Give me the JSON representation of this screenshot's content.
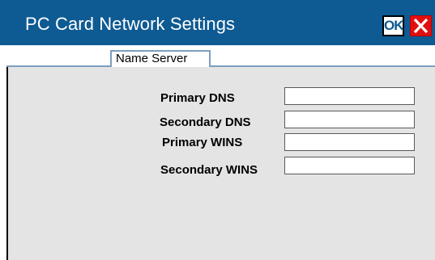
{
  "window": {
    "title": "PC Card Network Settings",
    "ok_label": "OK",
    "close_icon": "close-icon",
    "colors": {
      "titlebar": "#0e5a93",
      "panel": "#e4e4e4",
      "close": "#e01010"
    }
  },
  "tabs": [
    {
      "label": "Name Server",
      "selected": true
    }
  ],
  "fields": [
    {
      "label": "Primary DNS",
      "value": ""
    },
    {
      "label": "Secondary DNS",
      "value": ""
    },
    {
      "label": "Primary WINS",
      "value": ""
    },
    {
      "label": "Secondary WINS",
      "value": ""
    }
  ]
}
